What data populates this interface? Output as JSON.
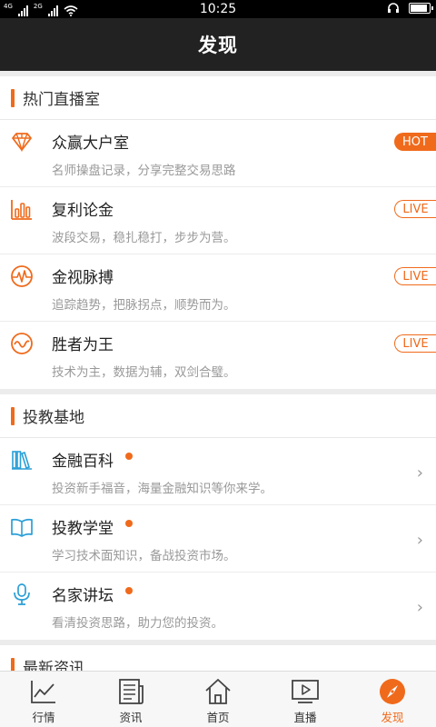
{
  "status": {
    "time": "10:25",
    "net_1": "4G",
    "net_2": "2G"
  },
  "header": {
    "title": "发现"
  },
  "sections": [
    {
      "title": "热门直播室",
      "items": [
        {
          "name": "众赢大户室",
          "desc": "名师操盘记录，分享完整交易思路",
          "badge": "HOT",
          "icon": "diamond-icon"
        },
        {
          "name": "复利论金",
          "desc": "波段交易，稳扎稳打，步步为营。",
          "badge": "LIVE",
          "icon": "bar-chart-icon"
        },
        {
          "name": "金视脉搏",
          "desc": "追踪趋势，把脉拐点，顺势而为。",
          "badge": "LIVE",
          "icon": "pulse-icon"
        },
        {
          "name": "胜者为王",
          "desc": "技术为主，数据为辅，双剑合璧。",
          "badge": "LIVE",
          "icon": "wave-icon"
        }
      ]
    },
    {
      "title": "投教基地",
      "items": [
        {
          "name": "金融百科",
          "desc": "投资新手福音，海量金融知识等你来学。",
          "icon": "books-icon"
        },
        {
          "name": "投教学堂",
          "desc": "学习技术面知识，备战投资市场。",
          "icon": "open-book-icon"
        },
        {
          "name": "名家讲坛",
          "desc": "看清投资思路，助力您的投资。",
          "icon": "microphone-icon"
        }
      ]
    },
    {
      "title": "最新资讯"
    }
  ],
  "tabs": [
    {
      "label": "行情",
      "icon": "line-chart-icon"
    },
    {
      "label": "资讯",
      "icon": "news-icon"
    },
    {
      "label": "首页",
      "icon": "home-icon"
    },
    {
      "label": "直播",
      "icon": "play-screen-icon"
    },
    {
      "label": "发现",
      "icon": "compass-icon",
      "active": true
    }
  ],
  "colors": {
    "accent": "#f06a1b",
    "blue_icon": "#2a9fd6",
    "header_bg": "#222222"
  },
  "battery_level": 0.95
}
